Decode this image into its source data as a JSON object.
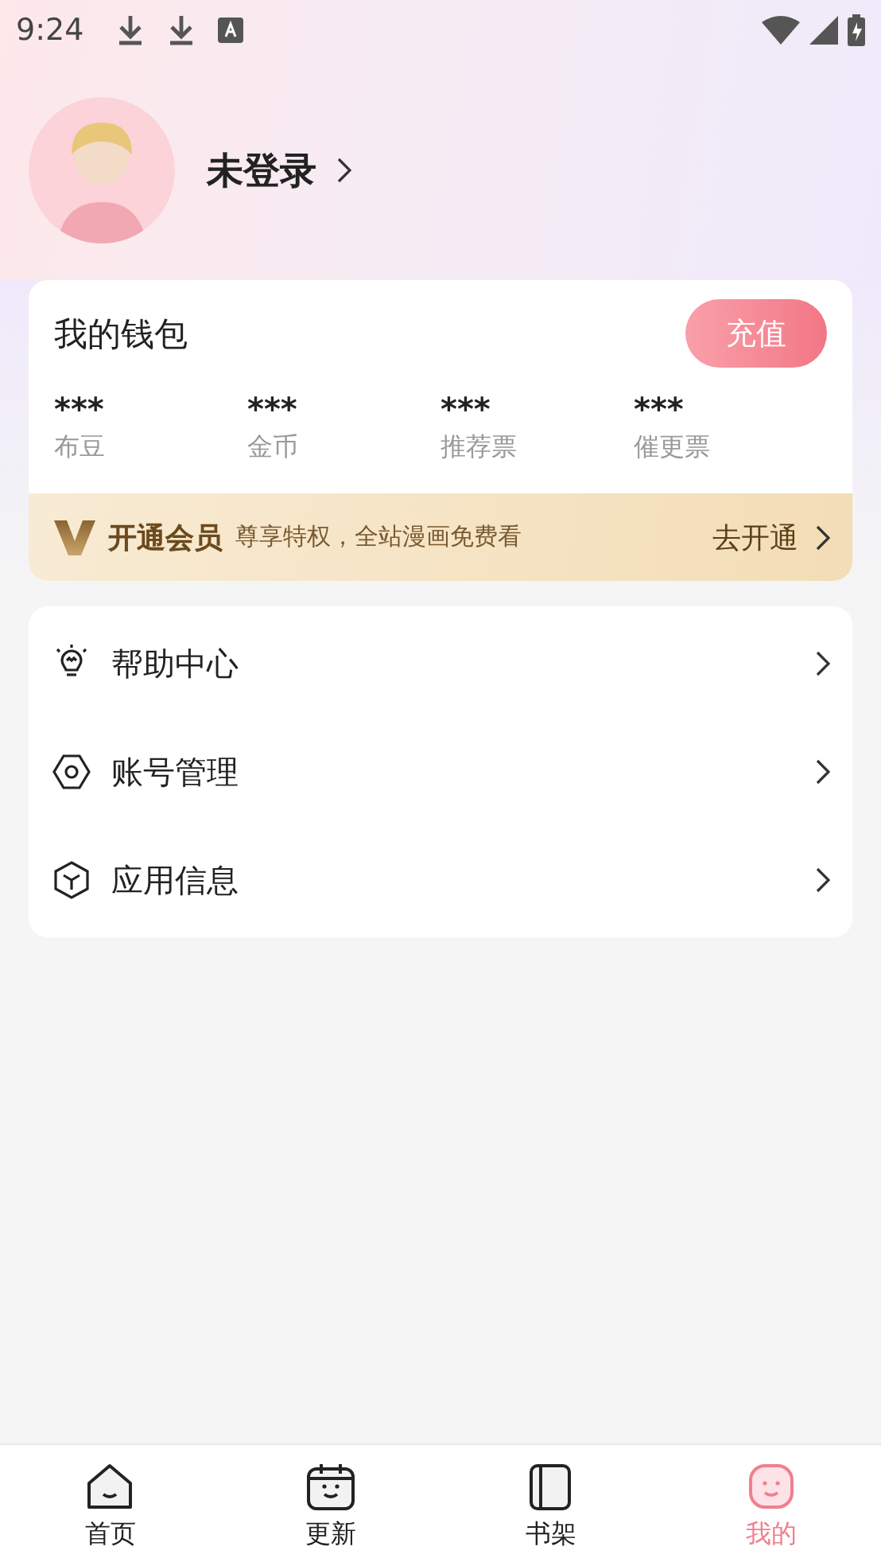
{
  "status_bar": {
    "time": "9:24"
  },
  "profile": {
    "name": "未登录"
  },
  "wallet": {
    "title": "我的钱包",
    "recharge_button": "充值",
    "stats": [
      {
        "value": "***",
        "label": "布豆"
      },
      {
        "value": "***",
        "label": "金币"
      },
      {
        "value": "***",
        "label": "推荐票"
      },
      {
        "value": "***",
        "label": "催更票"
      }
    ]
  },
  "vip_banner": {
    "title": "开通会员",
    "subtitle": "尊享特权，全站漫画免费看",
    "action": "去开通"
  },
  "menu": [
    {
      "kind": "help",
      "label": "帮助中心"
    },
    {
      "kind": "account",
      "label": "账号管理"
    },
    {
      "kind": "info",
      "label": "应用信息"
    }
  ],
  "bottom_nav": [
    {
      "kind": "home",
      "label": "首页",
      "selected": false
    },
    {
      "kind": "update",
      "label": "更新",
      "selected": false
    },
    {
      "kind": "shelf",
      "label": "书架",
      "selected": false
    },
    {
      "kind": "mine",
      "label": "我的",
      "selected": true
    }
  ]
}
